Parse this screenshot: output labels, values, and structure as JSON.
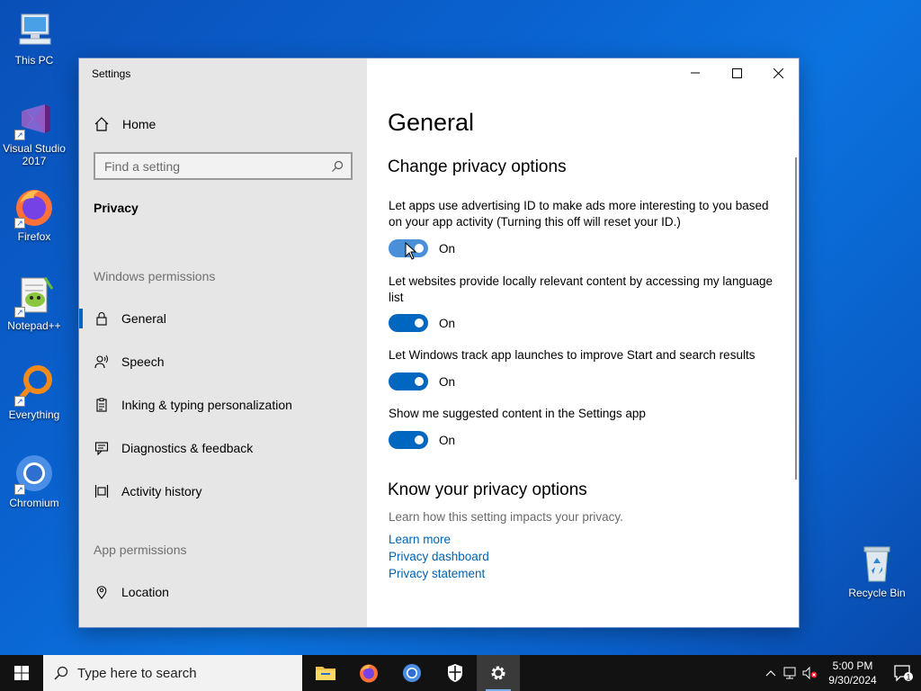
{
  "desktop": {
    "icons": [
      {
        "label": "This PC"
      },
      {
        "label": "Visual Studio 2017"
      },
      {
        "label": "Firefox"
      },
      {
        "label": "Notepad++"
      },
      {
        "label": "Everything"
      },
      {
        "label": "Chromium"
      },
      {
        "label": "Recycle Bin"
      }
    ]
  },
  "window": {
    "title": "Settings",
    "sidebar": {
      "home": "Home",
      "search_placeholder": "Find a setting",
      "section": "Privacy",
      "windows_permissions_label": "Windows permissions",
      "items": [
        {
          "label": "General",
          "icon": "lock-icon"
        },
        {
          "label": "Speech",
          "icon": "speech-icon"
        },
        {
          "label": "Inking & typing personalization",
          "icon": "clipboard-icon"
        },
        {
          "label": "Diagnostics & feedback",
          "icon": "feedback-icon"
        },
        {
          "label": "Activity history",
          "icon": "timeline-icon"
        }
      ],
      "app_permissions_label": "App permissions",
      "app_items": [
        {
          "label": "Location",
          "icon": "location-icon"
        }
      ]
    },
    "content": {
      "page_title": "General",
      "section_title": "Change privacy options",
      "settings": [
        {
          "text": "Let apps use advertising ID to make ads more interesting to you based on your app activity (Turning this off will reset your ID.)",
          "state": "On"
        },
        {
          "text": "Let websites provide locally relevant content by accessing my language list",
          "state": "On"
        },
        {
          "text": "Let Windows track app launches to improve Start and search results",
          "state": "On"
        },
        {
          "text": "Show me suggested content in the Settings app",
          "state": "On"
        }
      ],
      "know_title": "Know your privacy options",
      "know_text": "Learn how this setting impacts your privacy.",
      "links": [
        "Learn more",
        "Privacy dashboard",
        "Privacy statement"
      ]
    }
  },
  "taskbar": {
    "search_placeholder": "Type here to search",
    "time": "5:00 PM",
    "date": "9/30/2024",
    "notification_count": "1"
  },
  "colors": {
    "accent": "#0067c0",
    "link": "#0063b1",
    "sidebar_bg": "#e6e6e6",
    "taskbar_bg": "#121212"
  }
}
